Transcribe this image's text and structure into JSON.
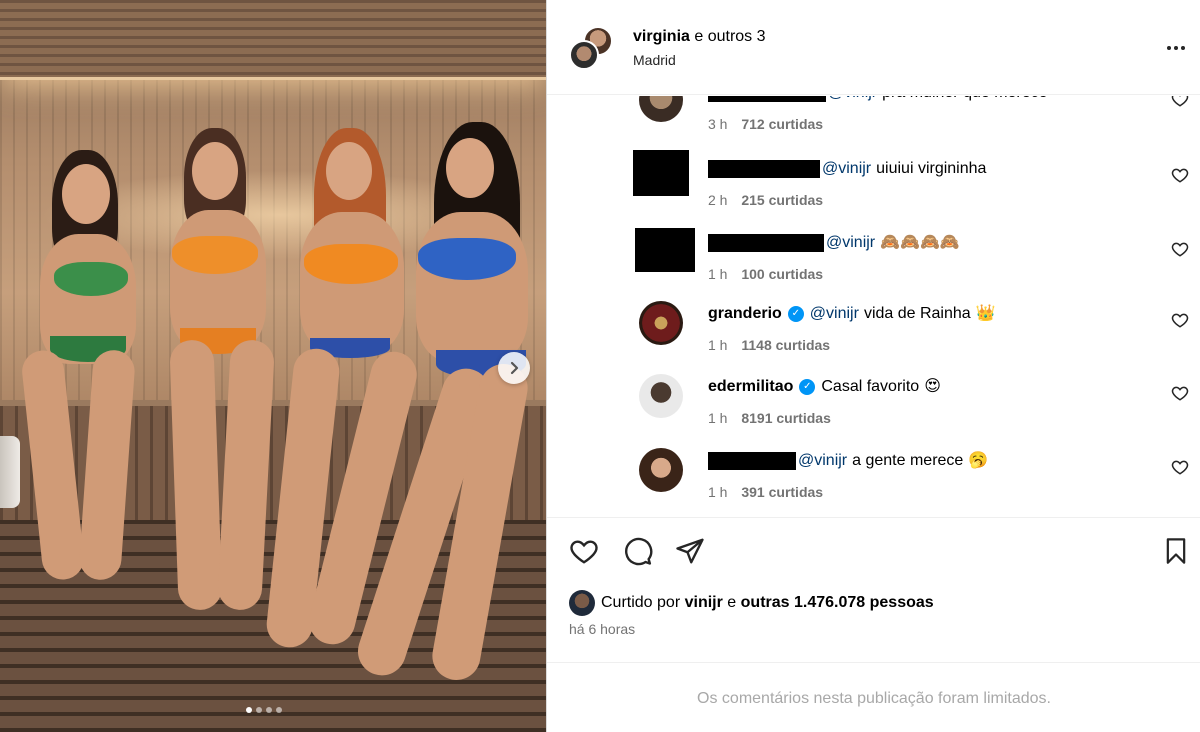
{
  "post": {
    "owner_username": "virginia",
    "owner_suffix": "e outros 3",
    "location": "Madrid",
    "more_icon": "more-horizontal-icon"
  },
  "carousel": {
    "next_icon": "chevron-right-icon",
    "dots_total": 4,
    "active_index": 0
  },
  "comments": [
    {
      "avatar": "photo",
      "redacted": true,
      "username": "",
      "mention": "@vinijr",
      "text": "pra mulher que merece",
      "emoji": "",
      "verified": false,
      "time": "3 h",
      "likes": "712 curtidas"
    },
    {
      "avatar": "censored",
      "redacted": true,
      "username": "",
      "mention": "@vinijr",
      "text": "uiuiui virgininha",
      "emoji": "",
      "verified": false,
      "time": "2 h",
      "likes": "215 curtidas"
    },
    {
      "avatar": "censored",
      "redacted": true,
      "username": "",
      "mention": "@vinijr",
      "text": "",
      "emoji": "🙈🙈🙈🙈",
      "verified": false,
      "time": "1 h",
      "likes": "100 curtidas"
    },
    {
      "avatar": "photo",
      "redacted": false,
      "username": "granderio",
      "mention": "@vinijr",
      "text": "vida de Rainha",
      "emoji": "👑",
      "verified": true,
      "time": "1 h",
      "likes": "1148 curtidas"
    },
    {
      "avatar": "photo",
      "redacted": false,
      "username": "edermilitao",
      "mention": "",
      "text": "Casal favorito",
      "emoji": "😍",
      "verified": true,
      "time": "1 h",
      "likes": "8191 curtidas"
    },
    {
      "avatar": "photo",
      "redacted": true,
      "username": "",
      "mention": "@vinijr",
      "text": "a gente merece",
      "emoji": "🥱",
      "verified": false,
      "time": "1 h",
      "likes": "391 curtidas"
    }
  ],
  "actions": {
    "like_icon": "heart-icon",
    "comment_icon": "comment-icon",
    "share_icon": "send-icon",
    "save_icon": "bookmark-icon"
  },
  "likes_summary": {
    "prefix": "Curtido por",
    "user": "vinijr",
    "middle": "e",
    "others": "outras 1.476.078 pessoas"
  },
  "time_ago": "há 6 horas",
  "comments_limited": "Os comentários nesta publicação foram limitados.",
  "colors": {
    "mention": "#00376b",
    "meta": "#737373",
    "verified": "#0095f6",
    "muted": "#a8a8a8"
  }
}
